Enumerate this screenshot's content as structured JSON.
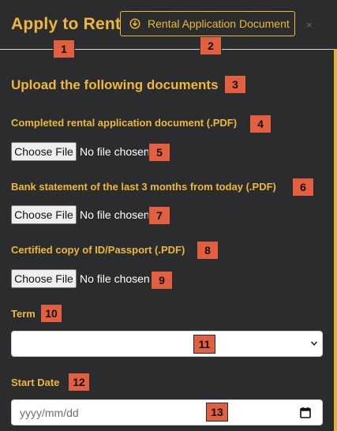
{
  "header": {
    "title": "Apply to Rent",
    "doc_button_label": "Rental Application Document",
    "close_glyph": "×"
  },
  "section_title": "Upload the following documents",
  "fields": {
    "rental_doc_label": "Completed rental application document (.PDF)",
    "bank_label": "Bank statement of the last 3 months from today (.PDF)",
    "id_label": "Certified copy of ID/Passport (.PDF)",
    "term_label": "Term",
    "start_date_label": "Start Date"
  },
  "file_input": {
    "choose_label": "Choose File",
    "no_file_text": "No file chosen"
  },
  "term_select": {
    "selected": ""
  },
  "start_date": {
    "placeholder": "yyyy/mm/dd"
  },
  "badges": [
    "1",
    "2",
    "3",
    "4",
    "5",
    "6",
    "7",
    "8",
    "9",
    "10",
    "11",
    "12",
    "13"
  ],
  "colors": {
    "background": "#2a2c2e",
    "accent": "#f0b834",
    "badge": "#e2603f"
  },
  "icons": {
    "doc_button": "download-circle-icon",
    "select": "chevron-down-icon",
    "date": "calendar-icon"
  }
}
